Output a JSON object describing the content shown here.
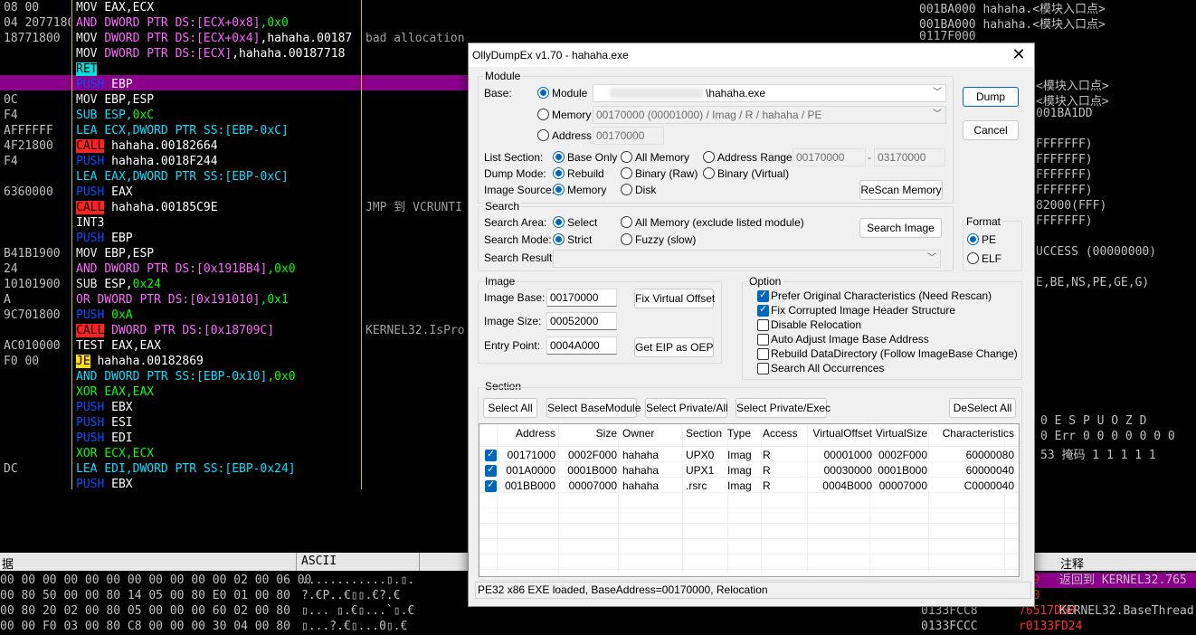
{
  "disasm": {
    "addresses": [
      "08 00",
      "04 2077180",
      "18771800",
      "",
      "",
      "",
      "0C",
      "F4",
      "AFFFFFF",
      "4F21800",
      "F4",
      "",
      "6360000",
      "",
      "",
      "",
      "B41B1900",
      "24",
      "10101900",
      "A",
      "9C701800",
      "",
      "AC010000",
      "F0 00",
      "",
      "",
      "",
      "",
      "",
      "",
      "DC",
      ""
    ],
    "rows": [
      {
        "m": "MOV",
        "cls": "m-mov",
        "ops": [
          {
            "t": "EAX,ECX",
            "c": "op"
          }
        ]
      },
      {
        "m": "AND",
        "cls": "m-and",
        "ops": [
          {
            "t": "DWORD PTR DS:[ECX+0x8]",
            "c": "op-mem"
          },
          {
            "t": ",0x0",
            "c": "op-hex"
          }
        ]
      },
      {
        "m": "MOV",
        "cls": "m-mov",
        "ops": [
          {
            "t": "DWORD PTR DS:[ECX+0x4]",
            "c": "op-mem"
          },
          {
            "t": ",hahaha.00187",
            "c": "op"
          }
        ]
      },
      {
        "m": "MOV",
        "cls": "m-mov",
        "ops": [
          {
            "t": "DWORD PTR DS:[ECX]",
            "c": "op-mem"
          },
          {
            "t": ",hahaha.00187718",
            "c": "op"
          }
        ]
      },
      {
        "m": "RET",
        "cls": "m-ret",
        "ops": []
      },
      {
        "m": "PUSH",
        "cls": "m-push",
        "ops": [
          {
            "t": "EBP",
            "c": "op"
          }
        ]
      },
      {
        "m": "MOV",
        "cls": "m-mov",
        "ops": [
          {
            "t": "EBP,ESP",
            "c": "op"
          }
        ]
      },
      {
        "m": "SUB",
        "cls": "m-sub",
        "ops": [
          {
            "t": "ESP,",
            "c": "op-lea"
          },
          {
            "t": "0xC",
            "c": "op-hex"
          }
        ]
      },
      {
        "m": "LEA",
        "cls": "m-lea",
        "ops": [
          {
            "t": "ECX,DWORD PTR SS:[EBP-0xC]",
            "c": "op-lea"
          }
        ]
      },
      {
        "m": "CALL",
        "cls": "m-call",
        "ops": [
          {
            "t": "hahaha.00182664",
            "c": "op"
          }
        ]
      },
      {
        "m": "PUSH",
        "cls": "m-push",
        "ops": [
          {
            "t": "hahaha.0018F244",
            "c": "op"
          }
        ]
      },
      {
        "m": "LEA",
        "cls": "m-lea",
        "ops": [
          {
            "t": "EAX,DWORD PTR SS:[EBP-0xC]",
            "c": "op-lea"
          }
        ]
      },
      {
        "m": "PUSH",
        "cls": "m-push",
        "ops": [
          {
            "t": "EAX",
            "c": "op"
          }
        ]
      },
      {
        "m": "CALL",
        "cls": "m-call",
        "ops": [
          {
            "t": "hahaha.00185C9E",
            "c": "op"
          }
        ]
      },
      {
        "m": "INT3",
        "cls": "m-int",
        "ops": []
      },
      {
        "m": "PUSH",
        "cls": "m-push",
        "ops": [
          {
            "t": "EBP",
            "c": "op"
          }
        ]
      },
      {
        "m": "MOV",
        "cls": "m-mov",
        "ops": [
          {
            "t": "EBP,ESP",
            "c": "op"
          }
        ]
      },
      {
        "m": "AND",
        "cls": "m-and",
        "ops": [
          {
            "t": "DWORD PTR DS:[0x191BB4]",
            "c": "op-mem"
          },
          {
            "t": ",0x0",
            "c": "op-hex"
          }
        ]
      },
      {
        "m": "SUB",
        "cls": "m-mov",
        "ops": [
          {
            "t": "ESP,",
            "c": "op"
          },
          {
            "t": "0x24",
            "c": "op-hex"
          }
        ]
      },
      {
        "m": "OR",
        "cls": "m-or",
        "ops": [
          {
            "t": "DWORD PTR DS:[0x191010]",
            "c": "op-mem"
          },
          {
            "t": ",0x1",
            "c": "op-hex"
          }
        ]
      },
      {
        "m": "PUSH",
        "cls": "m-push",
        "ops": [
          {
            "t": "0xA",
            "c": "op-hex"
          }
        ]
      },
      {
        "m": "CALL",
        "cls": "m-call",
        "ops": [
          {
            "t": "DWORD PTR DS:[0x18709C]",
            "c": "op-mem"
          }
        ]
      },
      {
        "m": "TEST",
        "cls": "m-test",
        "ops": [
          {
            "t": "EAX,EAX",
            "c": "op"
          }
        ]
      },
      {
        "m": "JE",
        "cls": "m-je",
        "ops": [
          {
            "t": "hahaha.00182869",
            "c": "op"
          }
        ]
      },
      {
        "m": "AND",
        "cls": "m-lea",
        "ops": [
          {
            "t": "DWORD PTR SS:[EBP-0x10]",
            "c": "op-lea"
          },
          {
            "t": ",0x0",
            "c": "op-hex"
          }
        ]
      },
      {
        "m": "XOR",
        "cls": "m-xor",
        "ops": [
          {
            "t": "EAX,EAX",
            "c": "op-hex"
          }
        ]
      },
      {
        "m": "PUSH",
        "cls": "m-push",
        "ops": [
          {
            "t": "EBX",
            "c": "op"
          }
        ]
      },
      {
        "m": "PUSH",
        "cls": "m-push",
        "ops": [
          {
            "t": "ESI",
            "c": "op"
          }
        ]
      },
      {
        "m": "PUSH",
        "cls": "m-push",
        "ops": [
          {
            "t": "EDI",
            "c": "op"
          }
        ]
      },
      {
        "m": "XOR",
        "cls": "m-xor",
        "ops": [
          {
            "t": "ECX,ECX",
            "c": "op-hex"
          }
        ]
      },
      {
        "m": "LEA",
        "cls": "m-lea",
        "ops": [
          {
            "t": "EDI,DWORD PTR SS:[EBP-0x24]",
            "c": "op-lea"
          }
        ]
      },
      {
        "m": "PUSH",
        "cls": "m-push",
        "ops": [
          {
            "t": "EBX",
            "c": "op"
          }
        ]
      }
    ],
    "comments": [
      "",
      "",
      "bad allocation",
      "",
      "",
      "",
      "",
      "",
      "",
      "",
      "",
      "",
      "",
      "JMP 到 VCRUNTI",
      "",
      "",
      "",
      "",
      "",
      "",
      "",
      "KERNEL32.IsPro",
      "",
      "",
      "",
      "",
      "",
      "",
      "",
      "",
      "",
      ""
    ]
  },
  "right_panel": {
    "lines": [
      "001BA000 hahaha.<模块入口点>",
      "001BA000 hahaha.<模块入口点>",
      "0117F000",
      "",
      "",
      "<模块入口点>",
      "<模块入口点>",
      "001BA1DD",
      "",
      "FFFFFFF)",
      "FFFFFFF)",
      "FFFFFFF)",
      "FFFFFFF)",
      "82000(FFF)",
      "FFFFFFF)",
      "",
      "UCCESS (00000000)",
      "",
      "E,BE,NS,PE,GE,G)",
      "",
      "",
      "",
      "",
      "",
      "",
      "",
      "",
      "0     E S P U O Z D",
      "0  Err 0 0 0 0 0 0 0",
      "53  掩码    1 1 1 1 1"
    ]
  },
  "dump": {
    "header_left": "据",
    "header_ascii": "ASCII",
    "rows": [
      {
        "hex": "00 00 00 00 00 00 00 00 00 00 00 02 00 06 00",
        "ascii": "............▯.▯."
      },
      {
        "hex": "00 80 50 00 00 80 14 05 00 80 E0 01 00 80",
        "ascii": "?.€P..€▯▯.€?.€"
      },
      {
        "hex": "00 80 20 02 00 80 05 00 00 00 60 02 00 80",
        "ascii": "▯... ▯.€▯...`▯.€"
      },
      {
        "hex": "00 00 F0 03 00 80 C8 00 00 00 30 04 00 80",
        "ascii": "▯...?.€▯...0▯.€"
      }
    ]
  },
  "stack": {
    "header_label": "注释",
    "rows": [
      {
        "addr": "",
        "val": "069",
        "cmt": "返回到 KERNEL32.765"
      },
      {
        "addr": "",
        "val": "000",
        "cmt": ""
      },
      {
        "addr": "0133FCC8",
        "val": "76517D50",
        "cmt": "KERNEL32.BaseThread"
      },
      {
        "addr": "0133FCCC",
        "val": "r0133FD24",
        "cmt": ""
      }
    ]
  },
  "dialog": {
    "title": "OllyDumpEx v1.70 - hahaha.exe",
    "close": "✕",
    "module_group": "Module",
    "base_label": "Base:",
    "radio_module": "Module",
    "radio_memory": "Memory",
    "radio_address": "Address",
    "module_value": "\\hahaha.exe",
    "memory_value": "00170000 (00001000) / Imag / R     / hahaha / PE",
    "address_value": "00170000",
    "list_section_label": "List Section:",
    "ls_base_only": "Base Only",
    "ls_all_memory": "All Memory",
    "ls_address_range": "Address Range",
    "range_from": "00170000",
    "range_dash": "-",
    "range_to": "03170000",
    "dump_mode_label": "Dump Mode:",
    "dm_rebuild": "Rebuild",
    "dm_binary_raw": "Binary (Raw)",
    "dm_binary_virtual": "Binary (Virtual)",
    "image_source_label": "Image Source:",
    "is_memory": "Memory",
    "is_disk": "Disk",
    "rescan_memory": "ReScan Memory",
    "dump": "Dump",
    "cancel": "Cancel",
    "search_group": "Search",
    "search_area_label": "Search Area:",
    "sa_select": "Select",
    "sa_all_memory": "All Memory (exclude listed module)",
    "search_image": "Search Image",
    "search_mode_label": "Search Mode:",
    "sm_strict": "Strict",
    "sm_fuzzy": "Fuzzy (slow)",
    "search_result_label": "Search Result:",
    "search_result_value": "",
    "format_group": "Format",
    "fmt_pe": "PE",
    "fmt_elf": "ELF",
    "image_group": "Image",
    "image_base_label": "Image Base:",
    "image_base_value": "00170000",
    "fix_virtual_offset": "Fix Virtual Offset",
    "image_size_label": "Image Size:",
    "image_size_value": "00052000",
    "entry_point_label": "Entry Point:",
    "entry_point_value": "0004A000",
    "get_eip_as_oep": "Get EIP as OEP",
    "option_group": "Option",
    "options": [
      {
        "label": "Prefer Original Characteristics (Need Rescan)",
        "checked": true
      },
      {
        "label": "Fix Corrupted Image Header Structure",
        "checked": true
      },
      {
        "label": "Disable Relocation",
        "checked": false
      },
      {
        "label": "Auto Adjust Image Base Address",
        "checked": false
      },
      {
        "label": "Rebuild DataDirectory (Follow ImageBase Change)",
        "checked": false
      },
      {
        "label": "Search All Occurrences",
        "checked": false
      }
    ],
    "section_group": "Section",
    "select_all": "Select All",
    "select_base_module": "Select BaseModule",
    "select_private_all": "Select Private/All",
    "select_private_exec": "Select Private/Exec",
    "deselect_all": "DeSelect All",
    "columns": [
      "Address",
      "Size",
      "Owner",
      "Section",
      "Type",
      "Access",
      "VirtualOffset",
      "VirtualSize",
      "Characteristics"
    ],
    "sections": [
      {
        "address": "00171000",
        "size": "0002F000",
        "owner": "hahaha",
        "section": "UPX0",
        "type": "Imag",
        "access": "R",
        "voffset": "00001000",
        "vsize": "0002F000",
        "chars": "60000080"
      },
      {
        "address": "001A0000",
        "size": "0001B000",
        "owner": "hahaha",
        "section": "UPX1",
        "type": "Imag",
        "access": "R",
        "voffset": "00030000",
        "vsize": "0001B000",
        "chars": "60000040"
      },
      {
        "address": "001BB000",
        "size": "00007000",
        "owner": "hahaha",
        "section": ".rsrc",
        "type": "Imag",
        "access": "R",
        "voffset": "0004B000",
        "vsize": "00007000",
        "chars": "C0000040"
      }
    ],
    "status": "PE32 x86 EXE loaded, BaseAddress=00170000, Relocation"
  }
}
